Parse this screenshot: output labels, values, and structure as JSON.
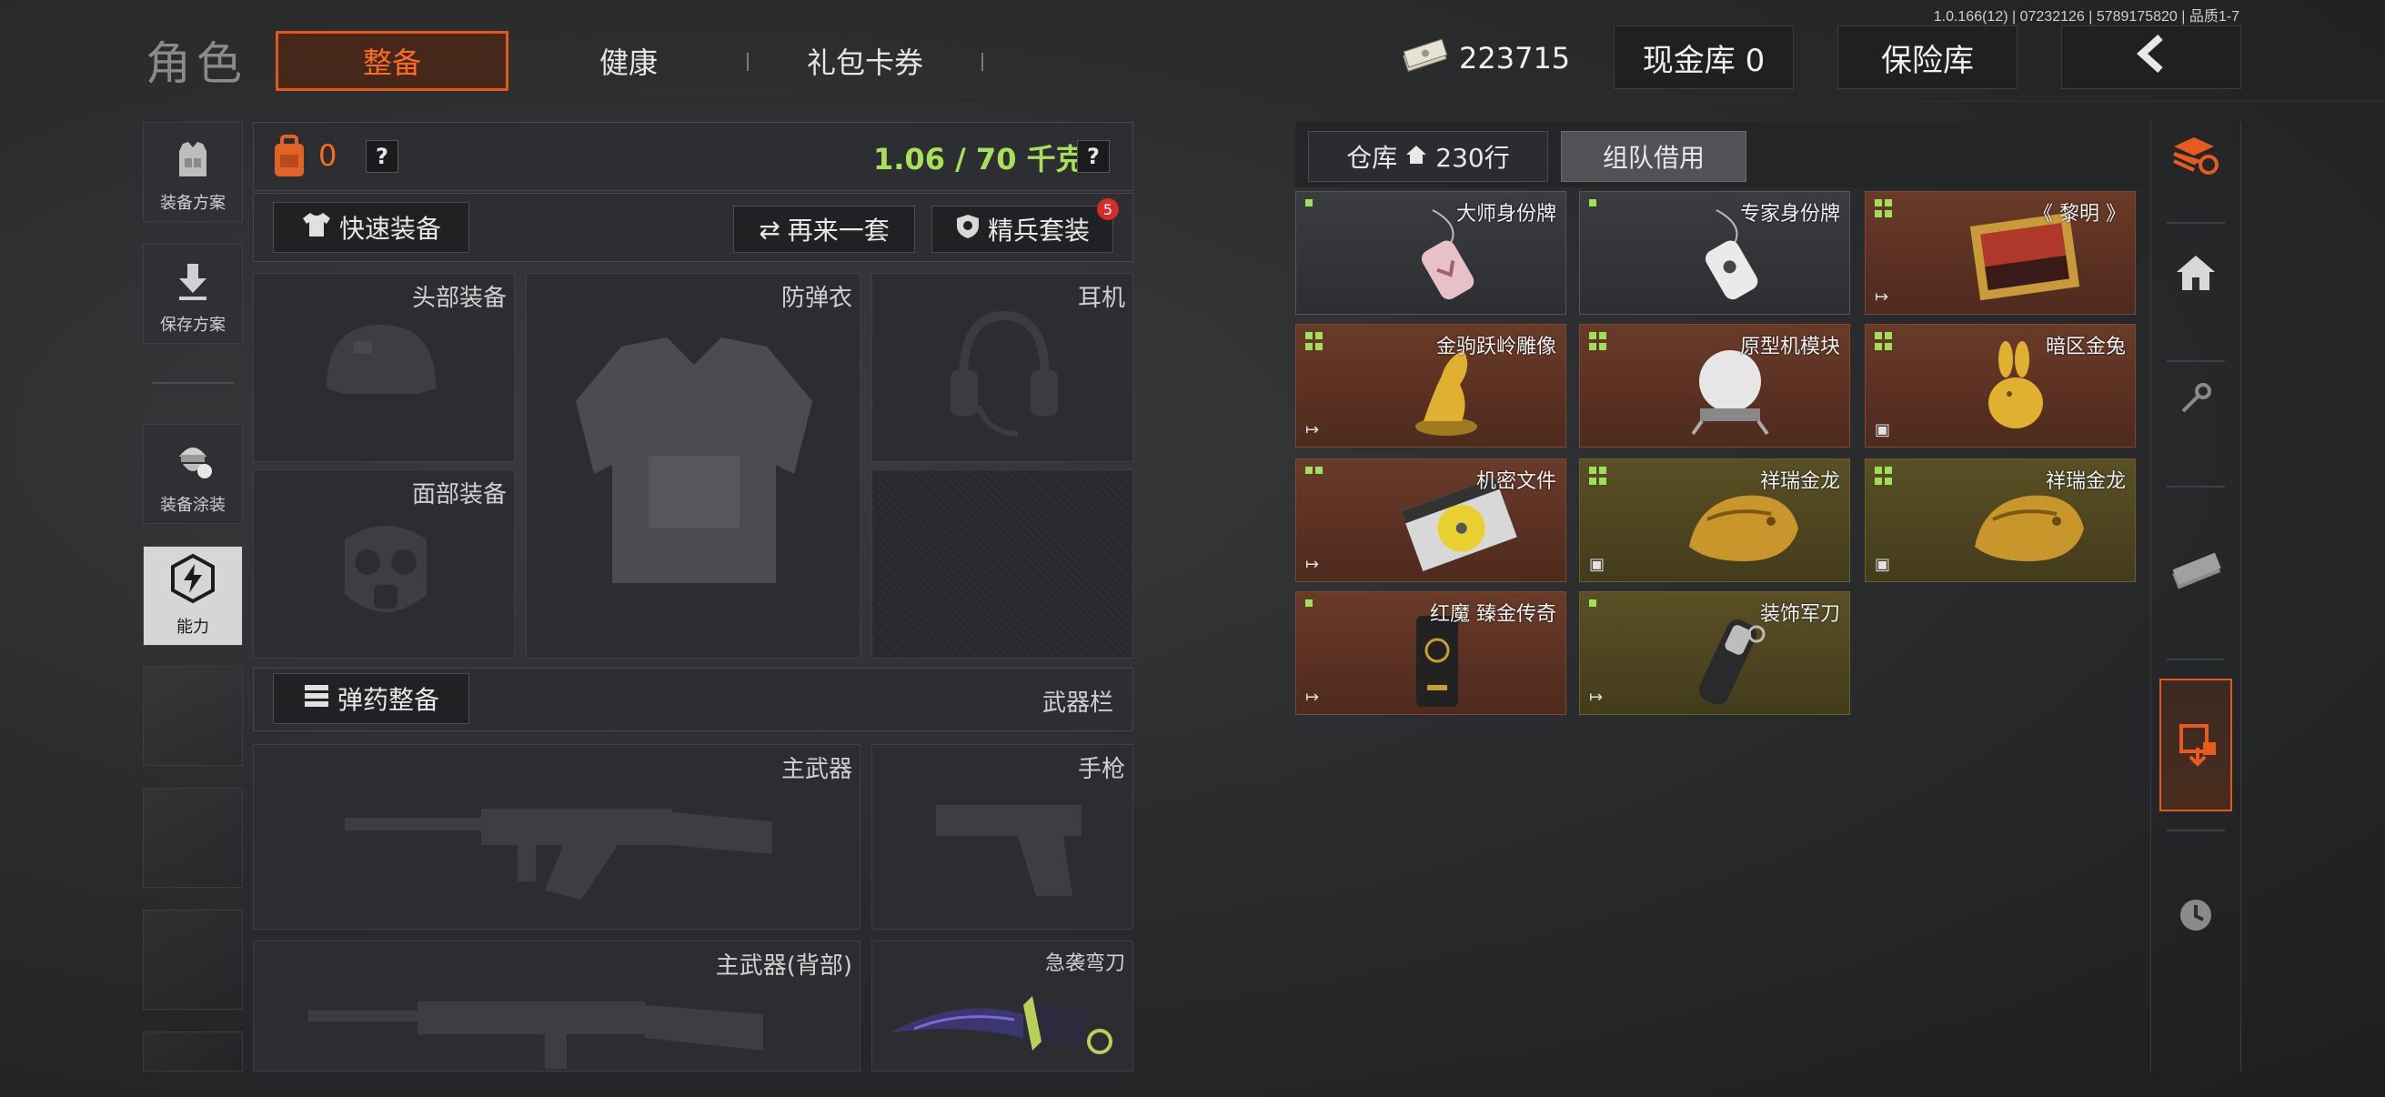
{
  "version": "1.0.166(12) | 07232126 | 5789175820 | 品质1-7",
  "header": {
    "page_title": "角色",
    "tabs": [
      {
        "label": "整备",
        "active": true
      },
      {
        "label": "健康",
        "active": false
      },
      {
        "label": "礼包卡券",
        "active": false
      }
    ],
    "currency_value": "223715",
    "cash_vault": "现金库 0",
    "safe_box": "保险库",
    "back_icon": "chevron-left-icon"
  },
  "sidebar": {
    "items": [
      {
        "label": "装备方案",
        "icon": "vest-icon"
      },
      {
        "label": "保存方案",
        "icon": "download-icon"
      },
      {
        "label": "装备涂装",
        "icon": "soldier-helmet-icon"
      },
      {
        "label": "能力",
        "icon": "lightning-hex-icon",
        "active": true
      }
    ]
  },
  "loadout": {
    "backpack_count": "0",
    "weight": "1.06 / 70 千克",
    "help": "?",
    "quick_equip": "快速装备",
    "redo_set": "再来一套",
    "elite_set": "精兵套装",
    "elite_badge": "5",
    "slots": {
      "head": "头部装备",
      "armor": "防弹衣",
      "headset": "耳机",
      "face": "面部装备"
    },
    "ammo_equip": "弹药整备",
    "weapon_bar": "武器栏",
    "weapons": {
      "primary": "主武器",
      "pistol": "手枪",
      "primary_back": "主武器(背部)",
      "knife": "急袭弯刀"
    }
  },
  "warehouse": {
    "tab_storage": "仓库",
    "storage_rows": "230行",
    "tab_team_borrow": "组队借用",
    "items": [
      {
        "label": "大师身份牌",
        "tier": "gray",
        "marker": "dot",
        "corner": ""
      },
      {
        "label": "专家身份牌",
        "tier": "gray",
        "marker": "dot",
        "corner": ""
      },
      {
        "label": "《 黎明 》",
        "tier": "red",
        "marker": "dots4",
        "corner": "↦"
      },
      {
        "label": "金驹跃岭雕像",
        "tier": "red",
        "marker": "dots4",
        "corner": "↦"
      },
      {
        "label": "原型机模块",
        "tier": "red",
        "marker": "dots4",
        "corner": ""
      },
      {
        "label": "暗区金兔",
        "tier": "red",
        "marker": "dots4",
        "corner": "▣"
      },
      {
        "label": "机密文件",
        "tier": "red",
        "marker": "dots2",
        "corner": "↦"
      },
      {
        "label": "祥瑞金龙",
        "tier": "gold",
        "marker": "dots4",
        "corner": "▣"
      },
      {
        "label": "祥瑞金龙",
        "tier": "gold",
        "marker": "dots4",
        "corner": "▣"
      },
      {
        "label": "红魔 臻金传奇",
        "tier": "red",
        "marker": "dot",
        "corner": "↦"
      },
      {
        "label": "装饰军刀",
        "tier": "gold",
        "marker": "dot",
        "corner": "↦"
      }
    ]
  },
  "right_nav": [
    {
      "icon": "layers-refresh-icon"
    },
    {
      "icon": "home-icon"
    },
    {
      "icon": "key-icon"
    },
    {
      "icon": "cash-icon"
    },
    {
      "icon": "box-transfer-icon",
      "active": true
    },
    {
      "icon": "clock-icon"
    }
  ],
  "colors": {
    "accent": "#ff6a22",
    "weight_green": "#a8e05a",
    "badge_red": "#d62b2b"
  }
}
